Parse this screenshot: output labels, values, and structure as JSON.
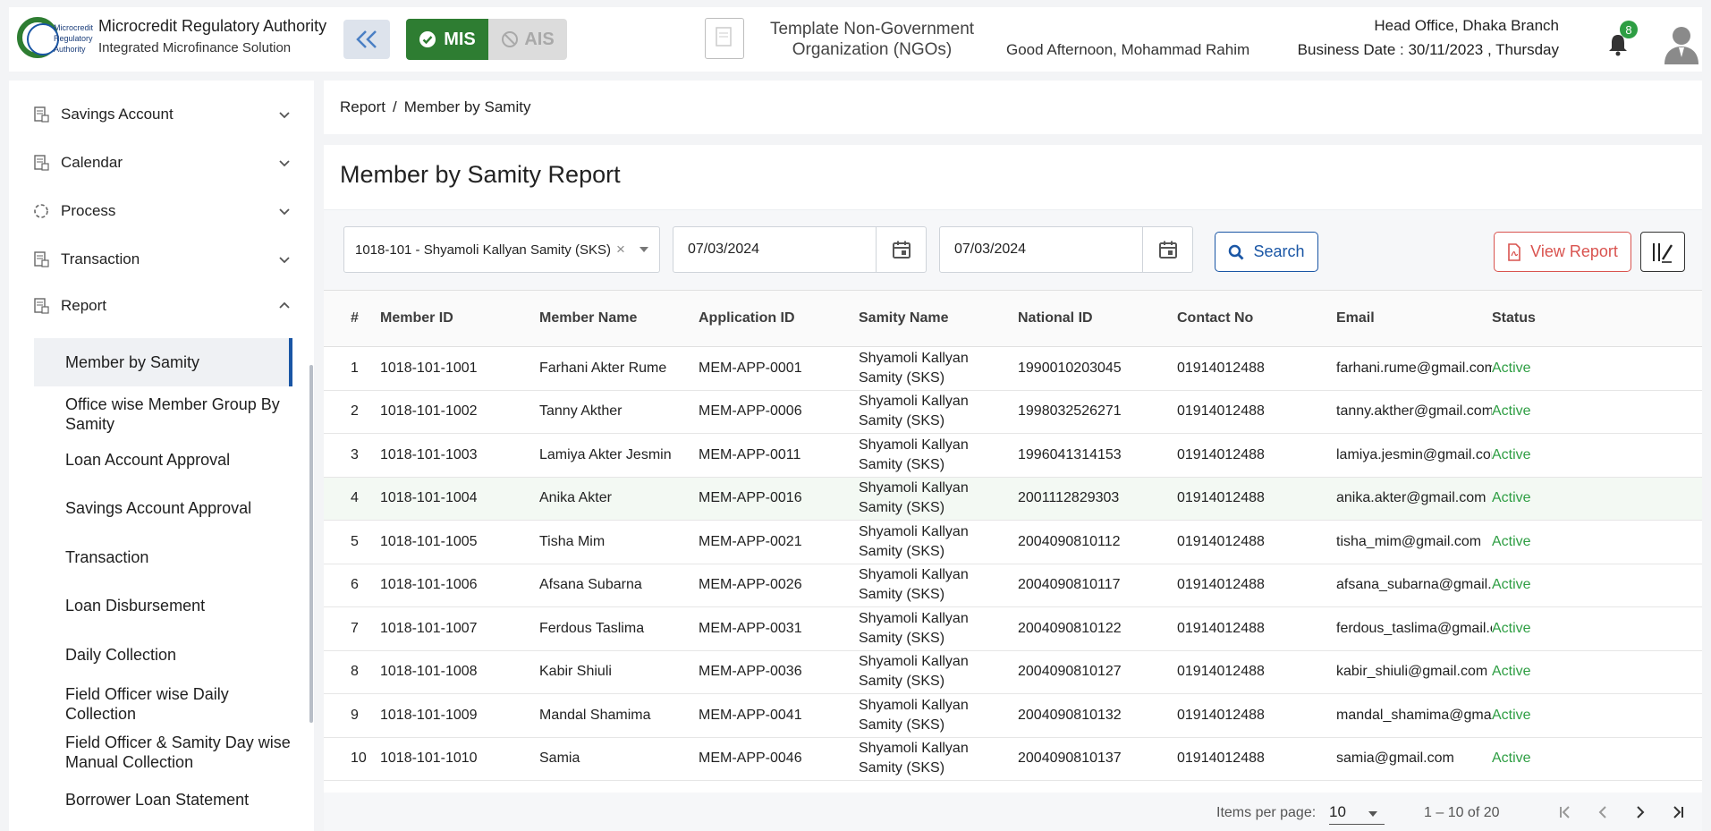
{
  "header": {
    "org_title": "Microcredit Regulatory Authority",
    "org_subtitle": "Integrated Microfinance Solution",
    "logo_text": [
      "Microcredit",
      "Regulatory",
      "Authority"
    ],
    "mis_label": "MIS",
    "ais_label": "AIS",
    "ngo_name_line1": "Template Non-Government",
    "ngo_name_line2": "Organization (NGOs)",
    "greeting": "Good Afternoon, Mohammad Rahim",
    "branch": "Head Office, Dhaka Branch",
    "business_date": "Business Date : 30/11/2023 , Thursday",
    "notification_count": "8"
  },
  "sidebar": {
    "items": [
      {
        "label": "Savings Account",
        "icon": "document-icon",
        "expanded": false
      },
      {
        "label": "Calendar",
        "icon": "document-icon",
        "expanded": false
      },
      {
        "label": "Process",
        "icon": "process-icon",
        "expanded": false
      },
      {
        "label": "Transaction",
        "icon": "document-icon",
        "expanded": false
      },
      {
        "label": "Report",
        "icon": "document-icon",
        "expanded": true
      }
    ],
    "report_subitems": [
      "Member by Samity",
      "Office wise Member Group By Samity",
      "Loan Account Approval",
      "Savings Account Approval",
      "Transaction",
      "Loan Disbursement",
      "Daily Collection",
      "Field Officer wise Daily Collection",
      "Field Officer & Samity Day wise Manual Collection",
      "Borrower Loan Statement"
    ],
    "active_subitem": "Member by Samity"
  },
  "breadcrumb": {
    "root": "Report",
    "separator": "/",
    "current": "Member by Samity"
  },
  "page": {
    "title": "Member by Samity Report"
  },
  "filters": {
    "samity_value": "1018-101 - Shyamoli Kallyan Samity (SKS)",
    "from_date": "07/03/2024",
    "to_date": "07/03/2024",
    "search_label": "Search",
    "view_report_label": "View Report"
  },
  "table": {
    "headers": [
      "#",
      "Member ID",
      "Member Name",
      "Application ID",
      "Samity Name",
      "National ID",
      "Contact No",
      "Email",
      "Status"
    ],
    "rows": [
      [
        "1",
        "1018-101-1001",
        "Farhani Akter Rume",
        "MEM-APP-0001",
        "Shyamoli Kallyan Samity (SKS)",
        "1990010203045",
        "01914012488",
        "farhani.rume@gmail.com",
        "Active"
      ],
      [
        "2",
        "1018-101-1002",
        "Tanny Akther",
        "MEM-APP-0006",
        "Shyamoli Kallyan Samity (SKS)",
        "1998032526271",
        "01914012488",
        "tanny.akther@gmail.com",
        "Active"
      ],
      [
        "3",
        "1018-101-1003",
        "Lamiya Akter Jesmin",
        "MEM-APP-0011",
        "Shyamoli Kallyan Samity (SKS)",
        "1996041314153",
        "01914012488",
        "lamiya.jesmin@gmail.com",
        "Active"
      ],
      [
        "4",
        "1018-101-1004",
        "Anika Akter",
        "MEM-APP-0016",
        "Shyamoli Kallyan Samity (SKS)",
        "2001112829303",
        "01914012488",
        "anika.akter@gmail.com",
        "Active"
      ],
      [
        "5",
        "1018-101-1005",
        "Tisha Mim",
        "MEM-APP-0021",
        "Shyamoli Kallyan Samity (SKS)",
        "2004090810112",
        "01914012488",
        "tisha_mim@gmail.com",
        "Active"
      ],
      [
        "6",
        "1018-101-1006",
        "Afsana Subarna",
        "MEM-APP-0026",
        "Shyamoli Kallyan Samity (SKS)",
        "2004090810117",
        "01914012488",
        "afsana_subarna@gmail.com",
        "Active"
      ],
      [
        "7",
        "1018-101-1007",
        "Ferdous Taslima",
        "MEM-APP-0031",
        "Shyamoli Kallyan Samity (SKS)",
        "2004090810122",
        "01914012488",
        "ferdous_taslima@gmail.com",
        "Active"
      ],
      [
        "8",
        "1018-101-1008",
        "Kabir Shiuli",
        "MEM-APP-0036",
        "Shyamoli Kallyan Samity (SKS)",
        "2004090810127",
        "01914012488",
        "kabir_shiuli@gmail.com",
        "Active"
      ],
      [
        "9",
        "1018-101-1009",
        "Mandal Shamima",
        "MEM-APP-0041",
        "Shyamoli Kallyan Samity (SKS)",
        "2004090810132",
        "01914012488",
        "mandal_shamima@gmail.com",
        "Active"
      ],
      [
        "10",
        "1018-101-1010",
        "Samia",
        "MEM-APP-0046",
        "Shyamoli Kallyan Samity (SKS)",
        "2004090810137",
        "01914012488",
        "samia@gmail.com",
        "Active"
      ]
    ],
    "highlighted_row": 4
  },
  "pagination": {
    "items_per_page_label": "Items per page:",
    "items_per_page": "10",
    "range": "1 – 10 of 20"
  },
  "colors": {
    "brand_green": "#2e7d32",
    "accent_blue": "#1a56a5",
    "danger_red": "#d9534f",
    "status_active": "#2e9e43"
  }
}
